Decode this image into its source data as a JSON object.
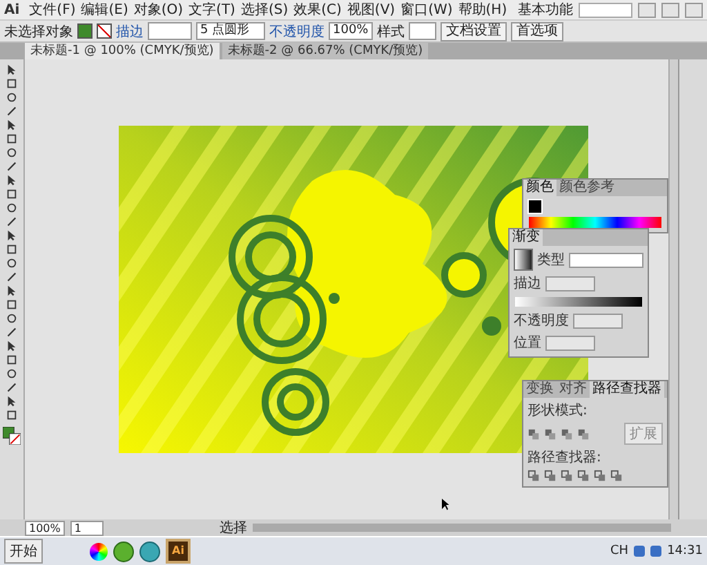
{
  "app": {
    "logo": "Ai",
    "menus": [
      "文件(F)",
      "编辑(E)",
      "对象(O)",
      "文字(T)",
      "选择(S)",
      "效果(C)",
      "视图(V)",
      "窗口(W)",
      "帮助(H)"
    ],
    "workspace": "基本功能"
  },
  "control_bar": {
    "label": "未选择对象",
    "stroke_label": "描边",
    "brush": "5 点圆形",
    "opacity_label": "不透明度",
    "opacity": "100%",
    "style_label": "样式",
    "buttons": [
      "文档设置",
      "首选项"
    ]
  },
  "doc_tabs": [
    {
      "label": "未标题-1 @ 100% (CMYK/预览)",
      "selected": true
    },
    {
      "label": "未标题-2 @ 66.67% (CMYK/预览)",
      "selected": false
    }
  ],
  "color_panel": {
    "tabs": [
      {
        "label": "颜色",
        "selected": true
      },
      {
        "label": "颜色参考",
        "selected": false
      }
    ]
  },
  "gradient_panel": {
    "tabs": [
      {
        "label": "渐变",
        "selected": true
      }
    ],
    "type_label": "类型",
    "stroke_label": "描边",
    "fields": [
      "不透明度",
      "位置"
    ]
  },
  "pathfinder_panel": {
    "tabs": [
      {
        "label": "变换",
        "selected": false
      },
      {
        "label": "对齐",
        "selected": false
      },
      {
        "label": "路径查找器",
        "selected": true
      }
    ],
    "shape_modes_label": "形状模式:",
    "expand": "扩展",
    "pathfinders_label": "路径查找器:"
  },
  "status_bar": {
    "zoom": "100%",
    "page": "1",
    "status": "选择"
  },
  "taskbar": {
    "start": "开始",
    "app_label": "Ai",
    "language": "CH",
    "clock": "14:31"
  }
}
